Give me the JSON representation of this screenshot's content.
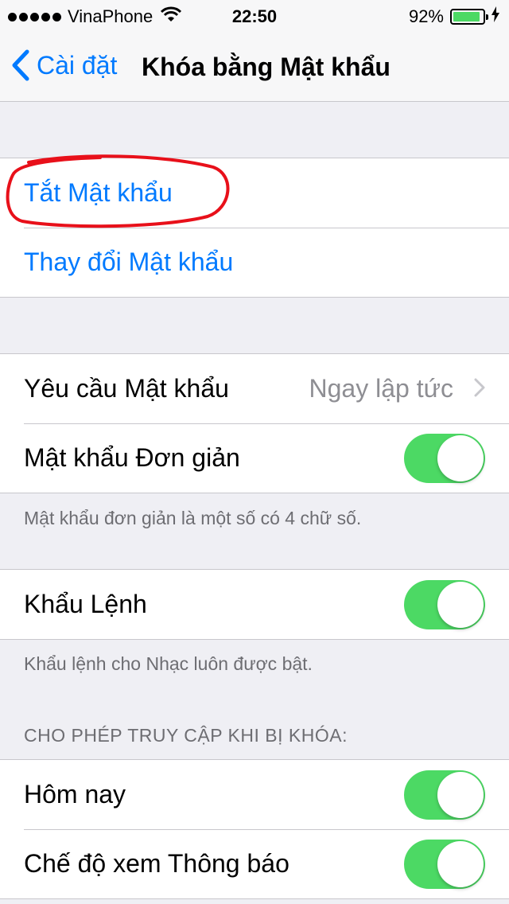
{
  "status_bar": {
    "carrier": "VinaPhone",
    "time": "22:50",
    "battery_percent": "92%",
    "battery_level": 0.92,
    "signal_icon": "signal-dots-icon",
    "wifi_icon": "wifi-icon",
    "charging_icon": "charging-bolt-icon"
  },
  "nav": {
    "back_label": "Cài đặt",
    "title": "Khóa bằng Mật khẩu"
  },
  "passcode_group": {
    "turn_off": "Tắt Mật khẩu",
    "change": "Thay đổi Mật khẩu"
  },
  "require_group": {
    "require_label": "Yêu cầu Mật khẩu",
    "require_value": "Ngay lập tức",
    "simple_label": "Mật khẩu Đơn giản",
    "simple_on": true,
    "footer": "Mật khẩu đơn giản là một số có 4 chữ số."
  },
  "voice_group": {
    "voice_label": "Khẩu Lệnh",
    "voice_on": true,
    "footer": "Khẩu lệnh cho Nhạc luôn được bật."
  },
  "locked_access": {
    "header": "CHO PHÉP TRUY CẬP KHI BỊ KHÓA:",
    "today_label": "Hôm nay",
    "today_on": true,
    "notifications_label": "Chế độ xem Thông báo",
    "notifications_on": true
  },
  "colors": {
    "accent": "#007aff",
    "toggle_on": "#4cd964",
    "annotation": "#e8101a"
  }
}
